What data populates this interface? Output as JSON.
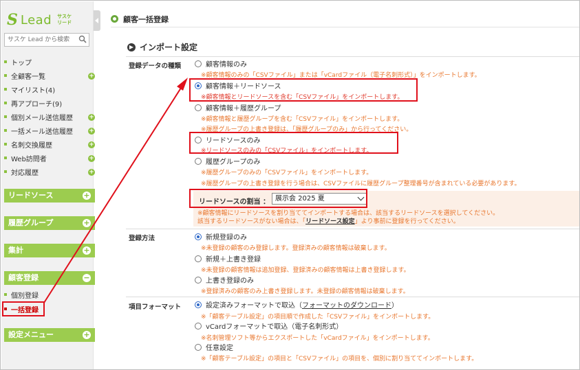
{
  "sidebar": {
    "logo_mark": "S",
    "logo_text": "Lead",
    "logo_sub_1": "サスケ",
    "logo_sub_2": "リード",
    "search_placeholder": "サスケ Lead から検索",
    "links": [
      {
        "label": "トップ",
        "plus": false
      },
      {
        "label": "全顧客一覧",
        "plus": true
      },
      {
        "label": "マイリスト(4)",
        "plus": false
      },
      {
        "label": "再アプローチ(9)",
        "plus": false
      },
      {
        "label": "個別メール送信履歴",
        "plus": true
      },
      {
        "label": "一括メール送信履歴",
        "plus": true
      },
      {
        "label": "名刺交換履歴",
        "plus": true
      },
      {
        "label": "Web訪問者",
        "plus": true
      },
      {
        "label": "対応履歴",
        "plus": true
      }
    ],
    "sections": {
      "lead_source": "リードソース",
      "history_group": "履歴グループ",
      "stats": "集計",
      "customer_reg": "顧客登録",
      "settings": "設定メニュー"
    },
    "sub_links": {
      "individual": "個別登録",
      "bulk": "一括登録"
    },
    "plus_symbol": "+",
    "minus_symbol": "−"
  },
  "page": {
    "title": "顧客一括登録",
    "section_title": "インポート設定"
  },
  "form": {
    "row1_label": "登録データの種類",
    "row2_label": "登録方法",
    "row3_label": "項目フォーマット",
    "data_type_options": [
      {
        "label": "顧客情報のみ",
        "notes": [
          "※顧客情報のみの「CSVファイル」または「vCardファイル（電子名刺形式）」をインポートします。"
        ]
      },
      {
        "label": "顧客情報＋リードソース",
        "notes": [
          "※顧客情報とリードソースを含む「CSVファイル」をインポートします。"
        ]
      },
      {
        "label": "顧客情報＋履歴グループ",
        "notes": [
          "※顧客情報と履歴グループを含む「CSVファイル」をインポートします。",
          "※履歴グループの上書き登録は、「履歴グループのみ」から行ってください。"
        ]
      },
      {
        "label": "リードソースのみ",
        "notes": [
          "※リードソースのみの「CSVファイル」をインポートします。"
        ]
      },
      {
        "label": "履歴グループのみ",
        "notes": [
          "※履歴グループのみの「CSVファイル」をインポートします。",
          "※履歴グループの上書き登録を行う場合は、CSVファイルに履歴グループ整理番号が含まれている必要があります。"
        ]
      }
    ],
    "lead_source_assign": {
      "label": "リードソースの割当",
      "colon": "：",
      "selected": "展示会 2025 夏",
      "note1": "※顧客情報にリードソースを割り当ててインポートする場合は、該当するリードソースを選択してください。",
      "note2_pre": "該当するリードソースがない場合は、「",
      "note2_link": "リードソース設定",
      "note2_post": "」より事前に登録を行ってください。"
    },
    "method_options": [
      {
        "label": "新規登録のみ",
        "note": "※未登録の顧客のみ登録します。登録済みの顧客情報は破棄します。"
      },
      {
        "label": "新規＋上書き登録",
        "note": "※未登録の顧客情報は追加登録、登録済みの顧客情報は上書き登録します。"
      },
      {
        "label": "上書き登録のみ",
        "note": "※登録済みの顧客のみ上書き登録します。未登録の顧客情報は破棄します。"
      }
    ],
    "format_options": {
      "opt1_pre": "設定済みフォーマットで取込（",
      "opt1_link": "フォーマットのダウンロード",
      "opt1_post": "）",
      "opt1_note": "※「顧客テーブル設定」の項目順で作成した「CSVファイル」をインポートします。",
      "opt2": "vCardフォーマットで取込（電子名刺形式）",
      "opt2_note": "※名刺管理ソフト等からエクスポートした「vCardファイル」をインポートします。",
      "opt3": "任意設定",
      "opt3_note": "※「顧客テーブル設定」の項目と「CSVファイル」の項目を、個別に割り当ててインポートします。"
    }
  },
  "colors": {
    "brand_green": "#8cc13f",
    "note_orange": "#e8762d",
    "highlight_red": "#e0101b"
  }
}
